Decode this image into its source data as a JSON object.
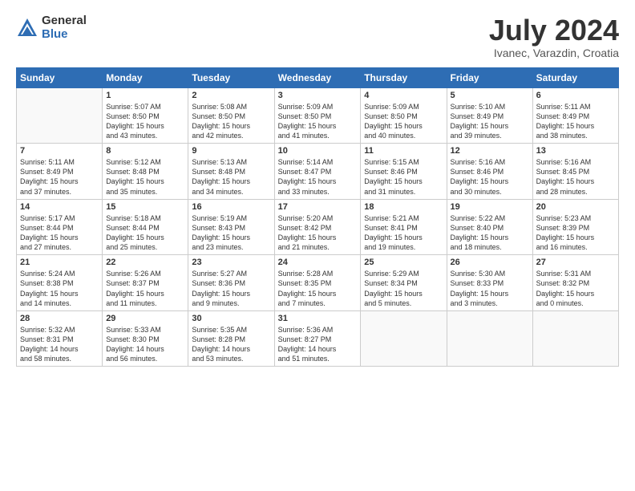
{
  "logo": {
    "general": "General",
    "blue": "Blue"
  },
  "title": "July 2024",
  "subtitle": "Ivanec, Varazdin, Croatia",
  "headers": [
    "Sunday",
    "Monday",
    "Tuesday",
    "Wednesday",
    "Thursday",
    "Friday",
    "Saturday"
  ],
  "weeks": [
    [
      {
        "day": "",
        "info": ""
      },
      {
        "day": "1",
        "info": "Sunrise: 5:07 AM\nSunset: 8:50 PM\nDaylight: 15 hours\nand 43 minutes."
      },
      {
        "day": "2",
        "info": "Sunrise: 5:08 AM\nSunset: 8:50 PM\nDaylight: 15 hours\nand 42 minutes."
      },
      {
        "day": "3",
        "info": "Sunrise: 5:09 AM\nSunset: 8:50 PM\nDaylight: 15 hours\nand 41 minutes."
      },
      {
        "day": "4",
        "info": "Sunrise: 5:09 AM\nSunset: 8:50 PM\nDaylight: 15 hours\nand 40 minutes."
      },
      {
        "day": "5",
        "info": "Sunrise: 5:10 AM\nSunset: 8:49 PM\nDaylight: 15 hours\nand 39 minutes."
      },
      {
        "day": "6",
        "info": "Sunrise: 5:11 AM\nSunset: 8:49 PM\nDaylight: 15 hours\nand 38 minutes."
      }
    ],
    [
      {
        "day": "7",
        "info": "Sunrise: 5:11 AM\nSunset: 8:49 PM\nDaylight: 15 hours\nand 37 minutes."
      },
      {
        "day": "8",
        "info": "Sunrise: 5:12 AM\nSunset: 8:48 PM\nDaylight: 15 hours\nand 35 minutes."
      },
      {
        "day": "9",
        "info": "Sunrise: 5:13 AM\nSunset: 8:48 PM\nDaylight: 15 hours\nand 34 minutes."
      },
      {
        "day": "10",
        "info": "Sunrise: 5:14 AM\nSunset: 8:47 PM\nDaylight: 15 hours\nand 33 minutes."
      },
      {
        "day": "11",
        "info": "Sunrise: 5:15 AM\nSunset: 8:46 PM\nDaylight: 15 hours\nand 31 minutes."
      },
      {
        "day": "12",
        "info": "Sunrise: 5:16 AM\nSunset: 8:46 PM\nDaylight: 15 hours\nand 30 minutes."
      },
      {
        "day": "13",
        "info": "Sunrise: 5:16 AM\nSunset: 8:45 PM\nDaylight: 15 hours\nand 28 minutes."
      }
    ],
    [
      {
        "day": "14",
        "info": "Sunrise: 5:17 AM\nSunset: 8:44 PM\nDaylight: 15 hours\nand 27 minutes."
      },
      {
        "day": "15",
        "info": "Sunrise: 5:18 AM\nSunset: 8:44 PM\nDaylight: 15 hours\nand 25 minutes."
      },
      {
        "day": "16",
        "info": "Sunrise: 5:19 AM\nSunset: 8:43 PM\nDaylight: 15 hours\nand 23 minutes."
      },
      {
        "day": "17",
        "info": "Sunrise: 5:20 AM\nSunset: 8:42 PM\nDaylight: 15 hours\nand 21 minutes."
      },
      {
        "day": "18",
        "info": "Sunrise: 5:21 AM\nSunset: 8:41 PM\nDaylight: 15 hours\nand 19 minutes."
      },
      {
        "day": "19",
        "info": "Sunrise: 5:22 AM\nSunset: 8:40 PM\nDaylight: 15 hours\nand 18 minutes."
      },
      {
        "day": "20",
        "info": "Sunrise: 5:23 AM\nSunset: 8:39 PM\nDaylight: 15 hours\nand 16 minutes."
      }
    ],
    [
      {
        "day": "21",
        "info": "Sunrise: 5:24 AM\nSunset: 8:38 PM\nDaylight: 15 hours\nand 14 minutes."
      },
      {
        "day": "22",
        "info": "Sunrise: 5:26 AM\nSunset: 8:37 PM\nDaylight: 15 hours\nand 11 minutes."
      },
      {
        "day": "23",
        "info": "Sunrise: 5:27 AM\nSunset: 8:36 PM\nDaylight: 15 hours\nand 9 minutes."
      },
      {
        "day": "24",
        "info": "Sunrise: 5:28 AM\nSunset: 8:35 PM\nDaylight: 15 hours\nand 7 minutes."
      },
      {
        "day": "25",
        "info": "Sunrise: 5:29 AM\nSunset: 8:34 PM\nDaylight: 15 hours\nand 5 minutes."
      },
      {
        "day": "26",
        "info": "Sunrise: 5:30 AM\nSunset: 8:33 PM\nDaylight: 15 hours\nand 3 minutes."
      },
      {
        "day": "27",
        "info": "Sunrise: 5:31 AM\nSunset: 8:32 PM\nDaylight: 15 hours\nand 0 minutes."
      }
    ],
    [
      {
        "day": "28",
        "info": "Sunrise: 5:32 AM\nSunset: 8:31 PM\nDaylight: 14 hours\nand 58 minutes."
      },
      {
        "day": "29",
        "info": "Sunrise: 5:33 AM\nSunset: 8:30 PM\nDaylight: 14 hours\nand 56 minutes."
      },
      {
        "day": "30",
        "info": "Sunrise: 5:35 AM\nSunset: 8:28 PM\nDaylight: 14 hours\nand 53 minutes."
      },
      {
        "day": "31",
        "info": "Sunrise: 5:36 AM\nSunset: 8:27 PM\nDaylight: 14 hours\nand 51 minutes."
      },
      {
        "day": "",
        "info": ""
      },
      {
        "day": "",
        "info": ""
      },
      {
        "day": "",
        "info": ""
      }
    ]
  ],
  "row_shades": [
    false,
    true,
    false,
    true,
    false
  ]
}
